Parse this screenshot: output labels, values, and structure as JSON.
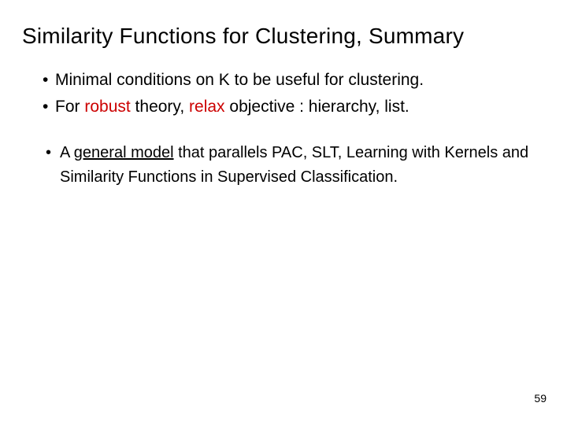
{
  "title": "Similarity Functions for Clustering, Summary",
  "bullets1": {
    "b1": "Minimal conditions on K to be useful for clustering.",
    "b2_pre": "For ",
    "b2_red1": "robust",
    "b2_mid1": " theory, ",
    "b2_red2": "relax",
    "b2_mid2": " objective : hierarchy, list."
  },
  "bullets2": {
    "b1_pre": "A ",
    "b1_underline": "general model",
    "b1_rest": " that parallels PAC, SLT, Learning with Kernels and Similarity Functions in Supervised Classification."
  },
  "page": "59"
}
